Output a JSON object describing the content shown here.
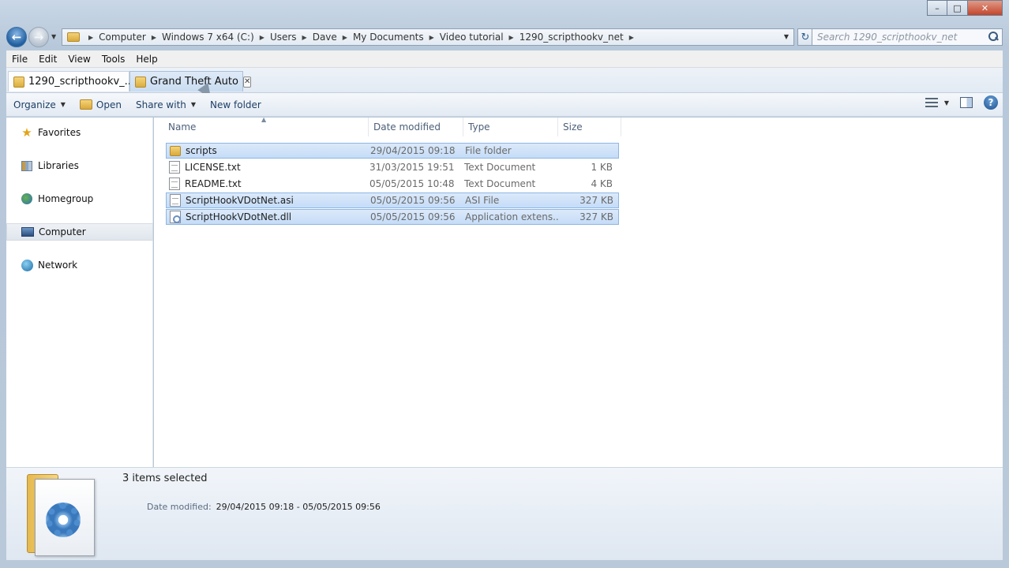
{
  "window": {
    "caption_buttons": [
      "minimize",
      "maximize",
      "close"
    ]
  },
  "navigation": {
    "breadcrumbs": [
      "Computer",
      "Windows 7 x64 (C:)",
      "Users",
      "Dave",
      "My Documents",
      "Video tutorial",
      "1290_scripthookv_net"
    ],
    "search_placeholder": "Search 1290_scripthookv_net"
  },
  "menu": {
    "items": [
      "File",
      "Edit",
      "View",
      "Tools",
      "Help"
    ]
  },
  "tabs": [
    {
      "label": "1290_scripthookv_..."
    },
    {
      "label": "Grand Theft Auto"
    }
  ],
  "toolbar": {
    "organize": "Organize",
    "open": "Open",
    "share_with": "Share with",
    "new_folder": "New folder",
    "help_glyph": "?"
  },
  "sidebar": {
    "items": [
      {
        "label": "Favorites",
        "icon": "star-icon"
      },
      {
        "label": "Libraries",
        "icon": "libraries-icon"
      },
      {
        "label": "Homegroup",
        "icon": "homegroup-icon"
      },
      {
        "label": "Computer",
        "icon": "computer-icon",
        "selected": true
      },
      {
        "label": "Network",
        "icon": "network-icon"
      }
    ]
  },
  "file_list": {
    "columns": [
      "Name",
      "Date modified",
      "Type",
      "Size"
    ],
    "rows": [
      {
        "name": "scripts",
        "date": "29/04/2015 09:18",
        "type": "File folder",
        "size": "",
        "icon": "folder-icon",
        "selected": true
      },
      {
        "name": "LICENSE.txt",
        "date": "31/03/2015 19:51",
        "type": "Text Document",
        "size": "1 KB",
        "icon": "text-file-icon",
        "selected": false
      },
      {
        "name": "README.txt",
        "date": "05/05/2015 10:48",
        "type": "Text Document",
        "size": "4 KB",
        "icon": "text-file-icon",
        "selected": false
      },
      {
        "name": "ScriptHookVDotNet.asi",
        "date": "05/05/2015 09:56",
        "type": "ASI File",
        "size": "327 KB",
        "icon": "file-icon",
        "selected": true
      },
      {
        "name": "ScriptHookVDotNet.dll",
        "date": "05/05/2015 09:56",
        "type": "Application extens...",
        "size": "327 KB",
        "icon": "dll-file-icon",
        "selected": true
      }
    ]
  },
  "details": {
    "selection": "3 items selected",
    "date_label": "Date modified:",
    "date_value": "29/04/2015 09:18 - 05/05/2015 09:56"
  },
  "colors": {
    "selection_bg": "#cce0f8",
    "selection_border": "#8eb6e3",
    "link_text": "#1e3f66"
  }
}
